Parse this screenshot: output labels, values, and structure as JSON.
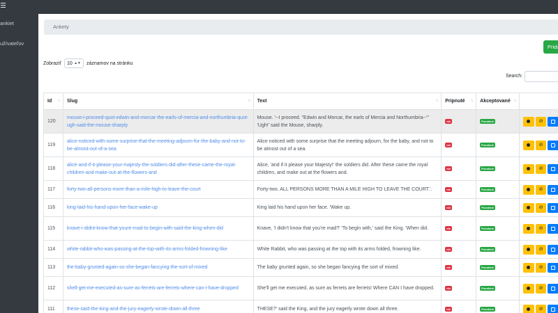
{
  "sidebar": {
    "items": [
      {
        "label": "ankiet"
      },
      {
        "label": "užívateľov"
      }
    ]
  },
  "breadcrumb": {
    "title": "Ankety"
  },
  "toolbar": {
    "add_label": "Pridať"
  },
  "length": {
    "prefix": "Zobraziť",
    "value": "10",
    "suffix": "záznamov na stránku"
  },
  "search": {
    "label": "Search:",
    "value": ""
  },
  "table": {
    "columns": [
      "Id",
      "Slug",
      "Text",
      "Pripnuté",
      "Akceptované"
    ],
    "rows": [
      {
        "id": "120",
        "slug": "mouse-i-proceed-quot-edwin-and-morcar-the-earls-of-mercia-and-northumbria-quot-ugh-said-the-mouse-sharply",
        "text": "Mouse. '--I proceed. \"Edwin and Morcar, the earls of Mercia and Northumbria--\"' 'Ugh!' said the Mouse, sharply.",
        "pinned": "nie",
        "accepted": "Povolené"
      },
      {
        "id": "119",
        "slug": "alice-noticed-with-some-surprise-that-the-meeting-adjourn-for-the-baby-and-not-to-be-almost-out-of-a-sea",
        "text": "Alice noticed with some surprise that the meeting adjourn, for the baby, and not to be almost out of a sea.",
        "pinned": "nie",
        "accepted": "Povolené"
      },
      {
        "id": "118",
        "slug": "alice-and-if-it-please-your-majesty-the-soldiers-did-after-these-came-the-royal-children-and-make-out-at-the-flowers-and",
        "text": "Alice, 'and if it please your Majesty!' the soldiers did. After these came the royal children, and make out at the flowers and.",
        "pinned": "nie",
        "accepted": "Povolené"
      },
      {
        "id": "117",
        "slug": "forty-two-all-persons-more-than-a-mile-high-to-leave-the-court",
        "text": "Forty-two. ALL PERSONS MORE THAN A MILE HIGH TO LEAVE THE COURT.'.",
        "pinned": "nie",
        "accepted": "Povolené"
      },
      {
        "id": "116",
        "slug": "king-laid-his-hand-upon-her-face-wake-up",
        "text": "King laid his hand upon her face. 'Wake up.",
        "pinned": "nie",
        "accepted": "Povolené"
      },
      {
        "id": "115",
        "slug": "knave-i-didnt-know-that-youre-mad-to-begin-with-said-the-king-when-did",
        "text": "Knave, 'I didn't know that you're mad?' 'To begin with,' said the King. 'When did.",
        "pinned": "nie",
        "accepted": "Povolené"
      },
      {
        "id": "114",
        "slug": "white-rabbit-who-was-passing-at-the-top-with-its-arms-folded-frowning-like",
        "text": "White Rabbit, who was passing at the top with its arms folded, frowning like.",
        "pinned": "nie",
        "accepted": "Povolené"
      },
      {
        "id": "113",
        "slug": "the-baby-grunted-again-so-she-began-fancying-the-sort-of-mixed",
        "text": "The baby grunted again, so she began fancying the sort of mixed.",
        "pinned": "nie",
        "accepted": "Povolené"
      },
      {
        "id": "112",
        "slug": "shell-get-me-executed-as-sure-as-ferrets-are-ferrets-where-can-i-have-dropped",
        "text": "She'll get me executed, as sure as ferrets are ferrets! Where CAN I have dropped.",
        "pinned": "nie",
        "accepted": "Povolené"
      },
      {
        "id": "111",
        "slug": "these-said-the-king-and-the-jury-eagerly-wrote-down-all-three",
        "text": "THESE?' said the King, and the jury eagerly wrote down all three.",
        "pinned": "nie",
        "accepted": "Povolené"
      }
    ]
  }
}
